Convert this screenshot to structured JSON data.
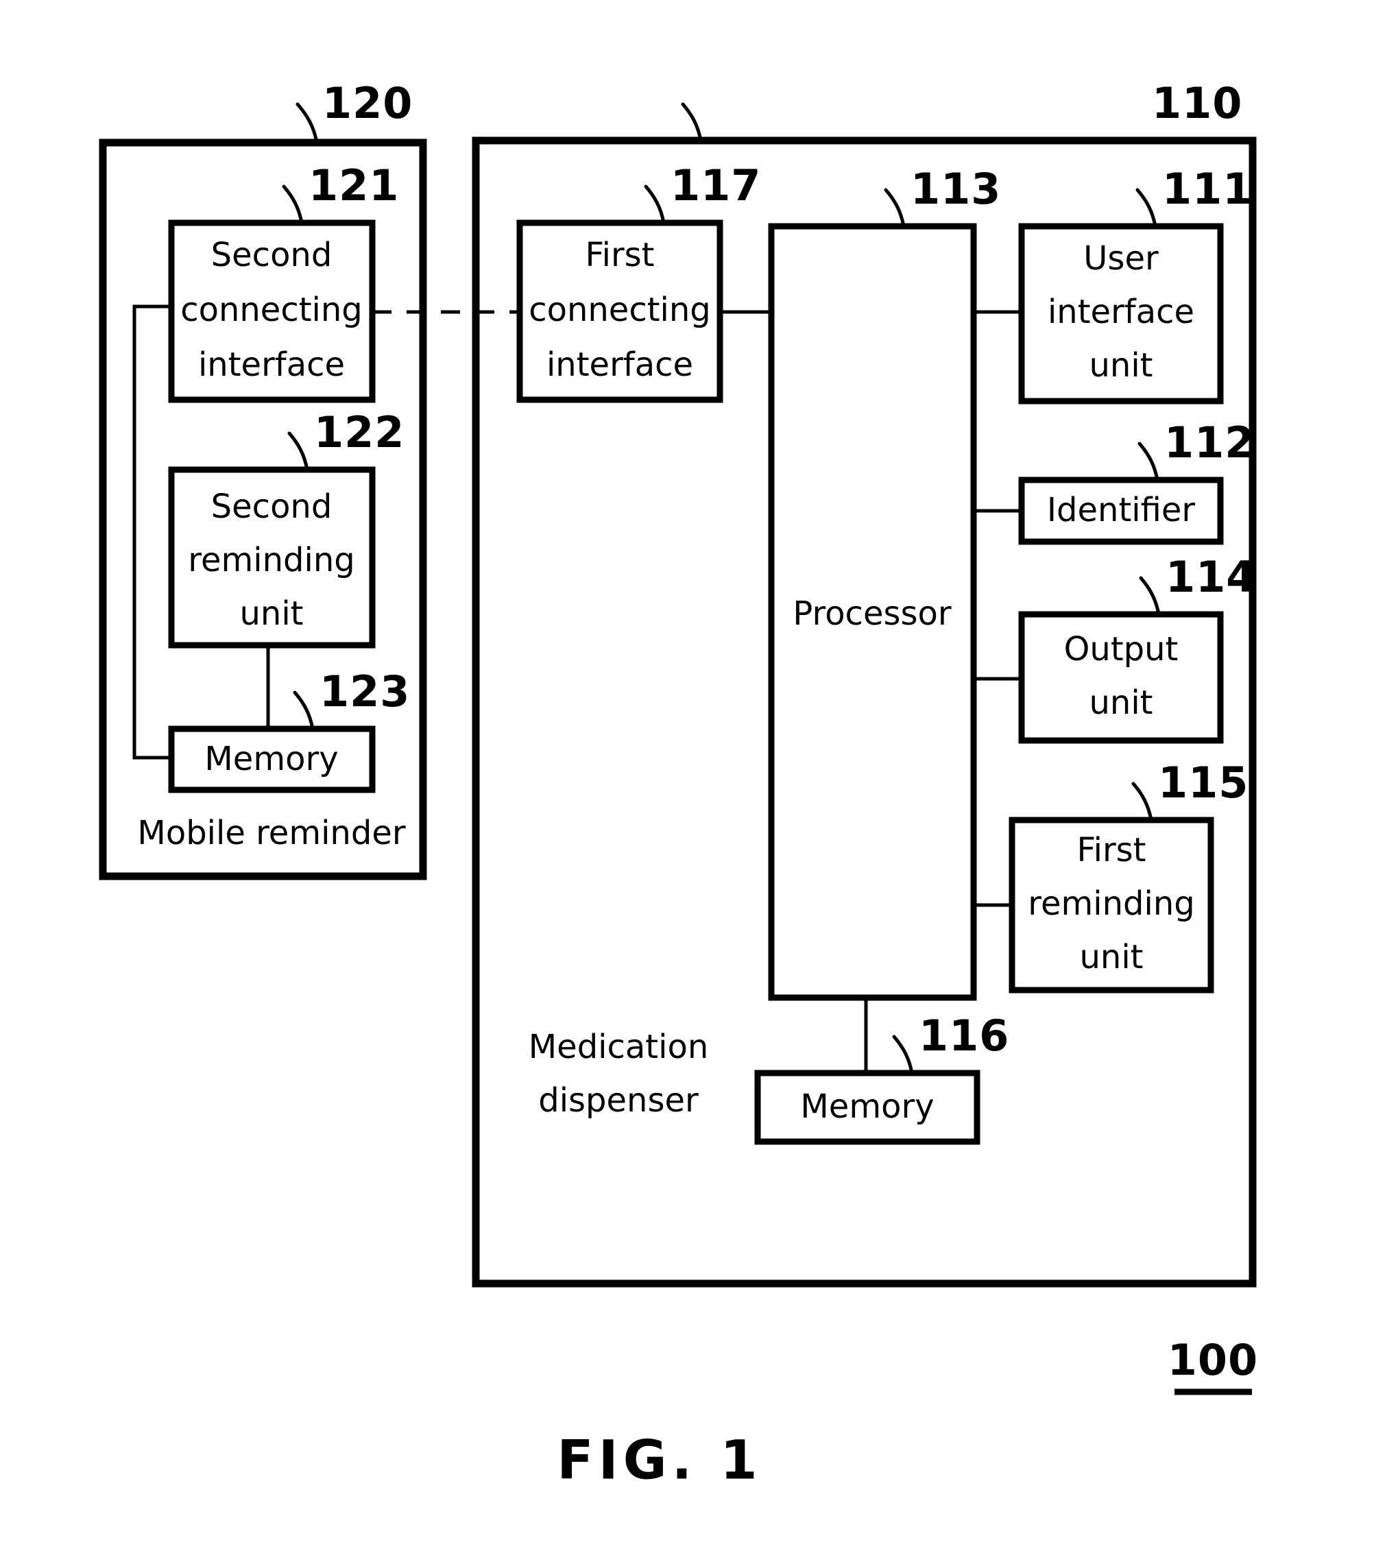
{
  "figure": {
    "caption": "FIG. 1",
    "system_reference": "100"
  },
  "devices": [
    {
      "id": "mobile-reminder",
      "reference": "120",
      "label": "Mobile  reminder"
    },
    {
      "id": "medication-dispenser",
      "reference": "110",
      "label_line1": "Medication",
      "label_line2": "dispenser"
    }
  ],
  "blocks": {
    "second_connecting_interface": {
      "reference": "121",
      "line1": "Second",
      "line2": "connecting",
      "line3": "interface"
    },
    "second_reminding_unit": {
      "reference": "122",
      "line1": "Second",
      "line2": "reminding",
      "line3": "unit"
    },
    "mobile_memory": {
      "reference": "123",
      "line1": "Memory"
    },
    "first_connecting_interface": {
      "reference": "117",
      "line1": "First",
      "line2": "connecting",
      "line3": "interface"
    },
    "processor": {
      "reference": "113",
      "line1": "Processor"
    },
    "user_interface_unit": {
      "reference": "111",
      "line1": "User",
      "line2": "interface",
      "line3": "unit"
    },
    "identifier": {
      "reference": "112",
      "line1": "Identifier"
    },
    "output_unit": {
      "reference": "114",
      "line1": "Output",
      "line2": "unit"
    },
    "first_reminding_unit": {
      "reference": "115",
      "line1": "First",
      "line2": "reminding",
      "line3": "unit"
    },
    "dispenser_memory": {
      "reference": "116",
      "line1": "Memory"
    }
  },
  "colors": {
    "ink": "#000000",
    "paper": "#ffffff"
  }
}
